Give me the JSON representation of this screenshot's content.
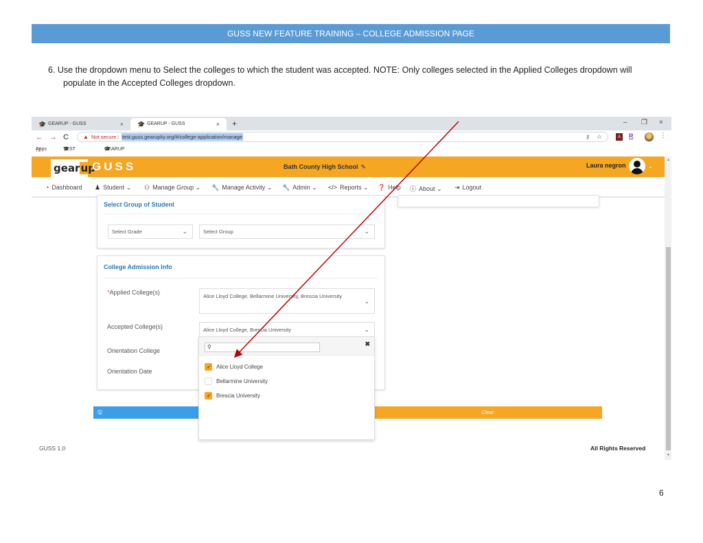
{
  "document": {
    "header": "GUSS NEW FEATURE TRAINING – COLLEGE ADMISSION PAGE",
    "instruction_line1": "6. Use the dropdown menu to Select the colleges to which the student was accepted. NOTE: Only colleges selected in the Applied Colleges dropdown will",
    "instruction_line2": "populate in the Accepted Colleges dropdown.",
    "page_number": "6"
  },
  "browser": {
    "tabs": [
      {
        "label": "GEARUP - GUSS",
        "close": "×"
      },
      {
        "label": "GEARUP - GUSS",
        "close": "×",
        "active": true
      }
    ],
    "new_tab": "+",
    "window_controls": {
      "minimize": "–",
      "restore": "❐",
      "close": "×"
    },
    "nav": {
      "back": "←",
      "forward": "→",
      "reload": "C"
    },
    "security_warning": "Not secure",
    "url": "test.guss.gearupky.org/#/college-application/manage",
    "extensions": {
      "pdf": "⅄",
      "r": "R"
    },
    "bookmarks": [
      {
        "label": "Apps",
        "icon": "apps-grid-icon"
      },
      {
        "label": "TEST - GUSS",
        "icon": "graduation-cap-icon"
      },
      {
        "label": "GEARUP - GUSS",
        "icon": "graduation-cap-icon"
      }
    ]
  },
  "app": {
    "logo_text_gear": "gear",
    "logo_text_up": "up",
    "title": "GUSS",
    "school": "Bath County High School",
    "user_name": "Laura negron",
    "nav": [
      {
        "label": "Dashboard",
        "icon": "dashboard-icon",
        "has_caret": false
      },
      {
        "label": "Student",
        "icon": "user-icon",
        "has_caret": true
      },
      {
        "label": "Manage Group",
        "icon": "users-icon",
        "has_caret": true
      },
      {
        "label": "Manage Activity",
        "icon": "wrench-icon",
        "has_caret": true
      },
      {
        "label": "Admin",
        "icon": "wrench-icon",
        "has_caret": true
      },
      {
        "label": "Reports",
        "icon": "code-icon",
        "has_caret": true
      },
      {
        "label": "Help",
        "icon": "question-icon",
        "has_caret": false
      },
      {
        "label": "About",
        "icon": "info-icon",
        "has_caret": true
      },
      {
        "label": "Logout",
        "icon": "sign-out-icon",
        "has_caret": false
      }
    ],
    "group_card": {
      "title": "Select Group of Student",
      "grade_placeholder": "Select Grade",
      "group_placeholder": "Select Group"
    },
    "admission_card": {
      "title": "College Admission Info",
      "applied_label_required": "*",
      "applied_label": "Applied College(s)",
      "applied_value": "Alice Lloyd College, Bellarmine University, Brescia University",
      "accepted_label": "Accepted College(s)",
      "accepted_value": "Alice Lloyd College, Brescia University",
      "orientation_college_label": "Orientation College",
      "orientation_date_label": "Orientation Date"
    },
    "accepted_dropdown": {
      "search_value": "",
      "close": "✖",
      "options": [
        {
          "label": "Alice Lloyd College",
          "checked": true
        },
        {
          "label": "Bellarmine University",
          "checked": false
        },
        {
          "label": "Brescia University",
          "checked": true
        }
      ]
    },
    "buttons": {
      "save_icon": "save-icon",
      "clear_label": "Clear"
    },
    "footer": {
      "version": "GUSS 1.0",
      "rights": "All Rights Reserved"
    }
  },
  "colors": {
    "doc_header": "#5b9bd5",
    "app_accent": "#f5a623",
    "title_blue": "#2a7ab8",
    "save_blue": "#3d9ee8",
    "annotation_arrow": "#c00000"
  }
}
